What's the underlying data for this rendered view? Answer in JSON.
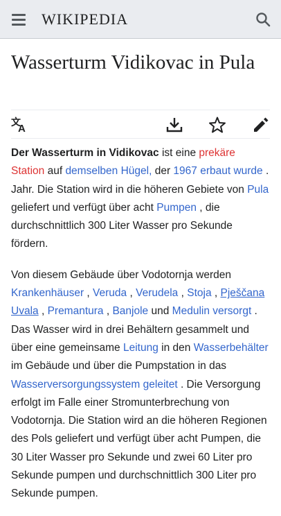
{
  "header": {
    "logo_text": "WIKIPEDIA",
    "menu_icon": "hamburger-menu-icon",
    "search_icon": "search-icon",
    "background": "#eaecf0"
  },
  "article": {
    "title": "Wasserturm Vidikovac in Pula"
  },
  "page_actions": [
    {
      "name": "language-icon",
      "label": "Sprache"
    },
    {
      "name": "download-icon",
      "label": "Herunterladen"
    },
    {
      "name": "star-icon",
      "label": "Beobachten"
    },
    {
      "name": "edit-pencil-icon",
      "label": "Bearbeiten"
    }
  ],
  "paragraph1": {
    "bold_subject": "Der Wasserturm in Vidikovac",
    "t1": " ist eine ",
    "l1": "prekäre Station",
    "t2": " auf ",
    "l2": "demselben Hügel,",
    "t3": " der ",
    "l3": "1967 erbaut wurde",
    "t4": " . Jahr. Die Station wird in die höheren Gebiete von ",
    "l4": "Pula",
    "t5": " geliefert und verfügt über acht ",
    "l5": "Pumpen",
    "t6": " , die durchschnittlich 300 Liter Wasser pro Sekunde fördern."
  },
  "paragraph2": {
    "t1": "Von diesem Gebäude über Vodotornja werden ",
    "l1": "Krankenhäuser",
    "t2": " , ",
    "l2": "Veruda",
    "t3": " , ",
    "l3": "Verudela",
    "t4": " , ",
    "l4": "Stoja",
    "t5": " , ",
    "l5": "Pješčana Uvala",
    "t6": " , ",
    "l6": "Premantura",
    "t7": " , ",
    "l7": "Banjole",
    "t8": " und ",
    "l8": "Medulin versorgt",
    "t9": " . Das Wasser wird in drei Behältern gesammelt und über eine gemeinsame ",
    "l9": "Leitung",
    "t10": " in den ",
    "l10": "Wasserbehälter",
    "t11": " im Gebäude und über die Pumpstation in das ",
    "l11": "Wasserversorgungssystem geleitet",
    "t12": " . Die Versorgung erfolgt im Falle einer Stromunterbrechung von Vodotornja. Die Station wird an die höheren Regionen des Pols geliefert und verfügt über acht Pumpen, die 30 Liter Wasser pro Sekunde und zwei 60 Liter pro Sekunde pumpen und durchschnittlich 300 Liter pro Sekunde pumpen."
  },
  "colors": {
    "link": "#3366cc",
    "redlink": "#dd3333",
    "text": "#202122",
    "icon": "#54595d"
  }
}
